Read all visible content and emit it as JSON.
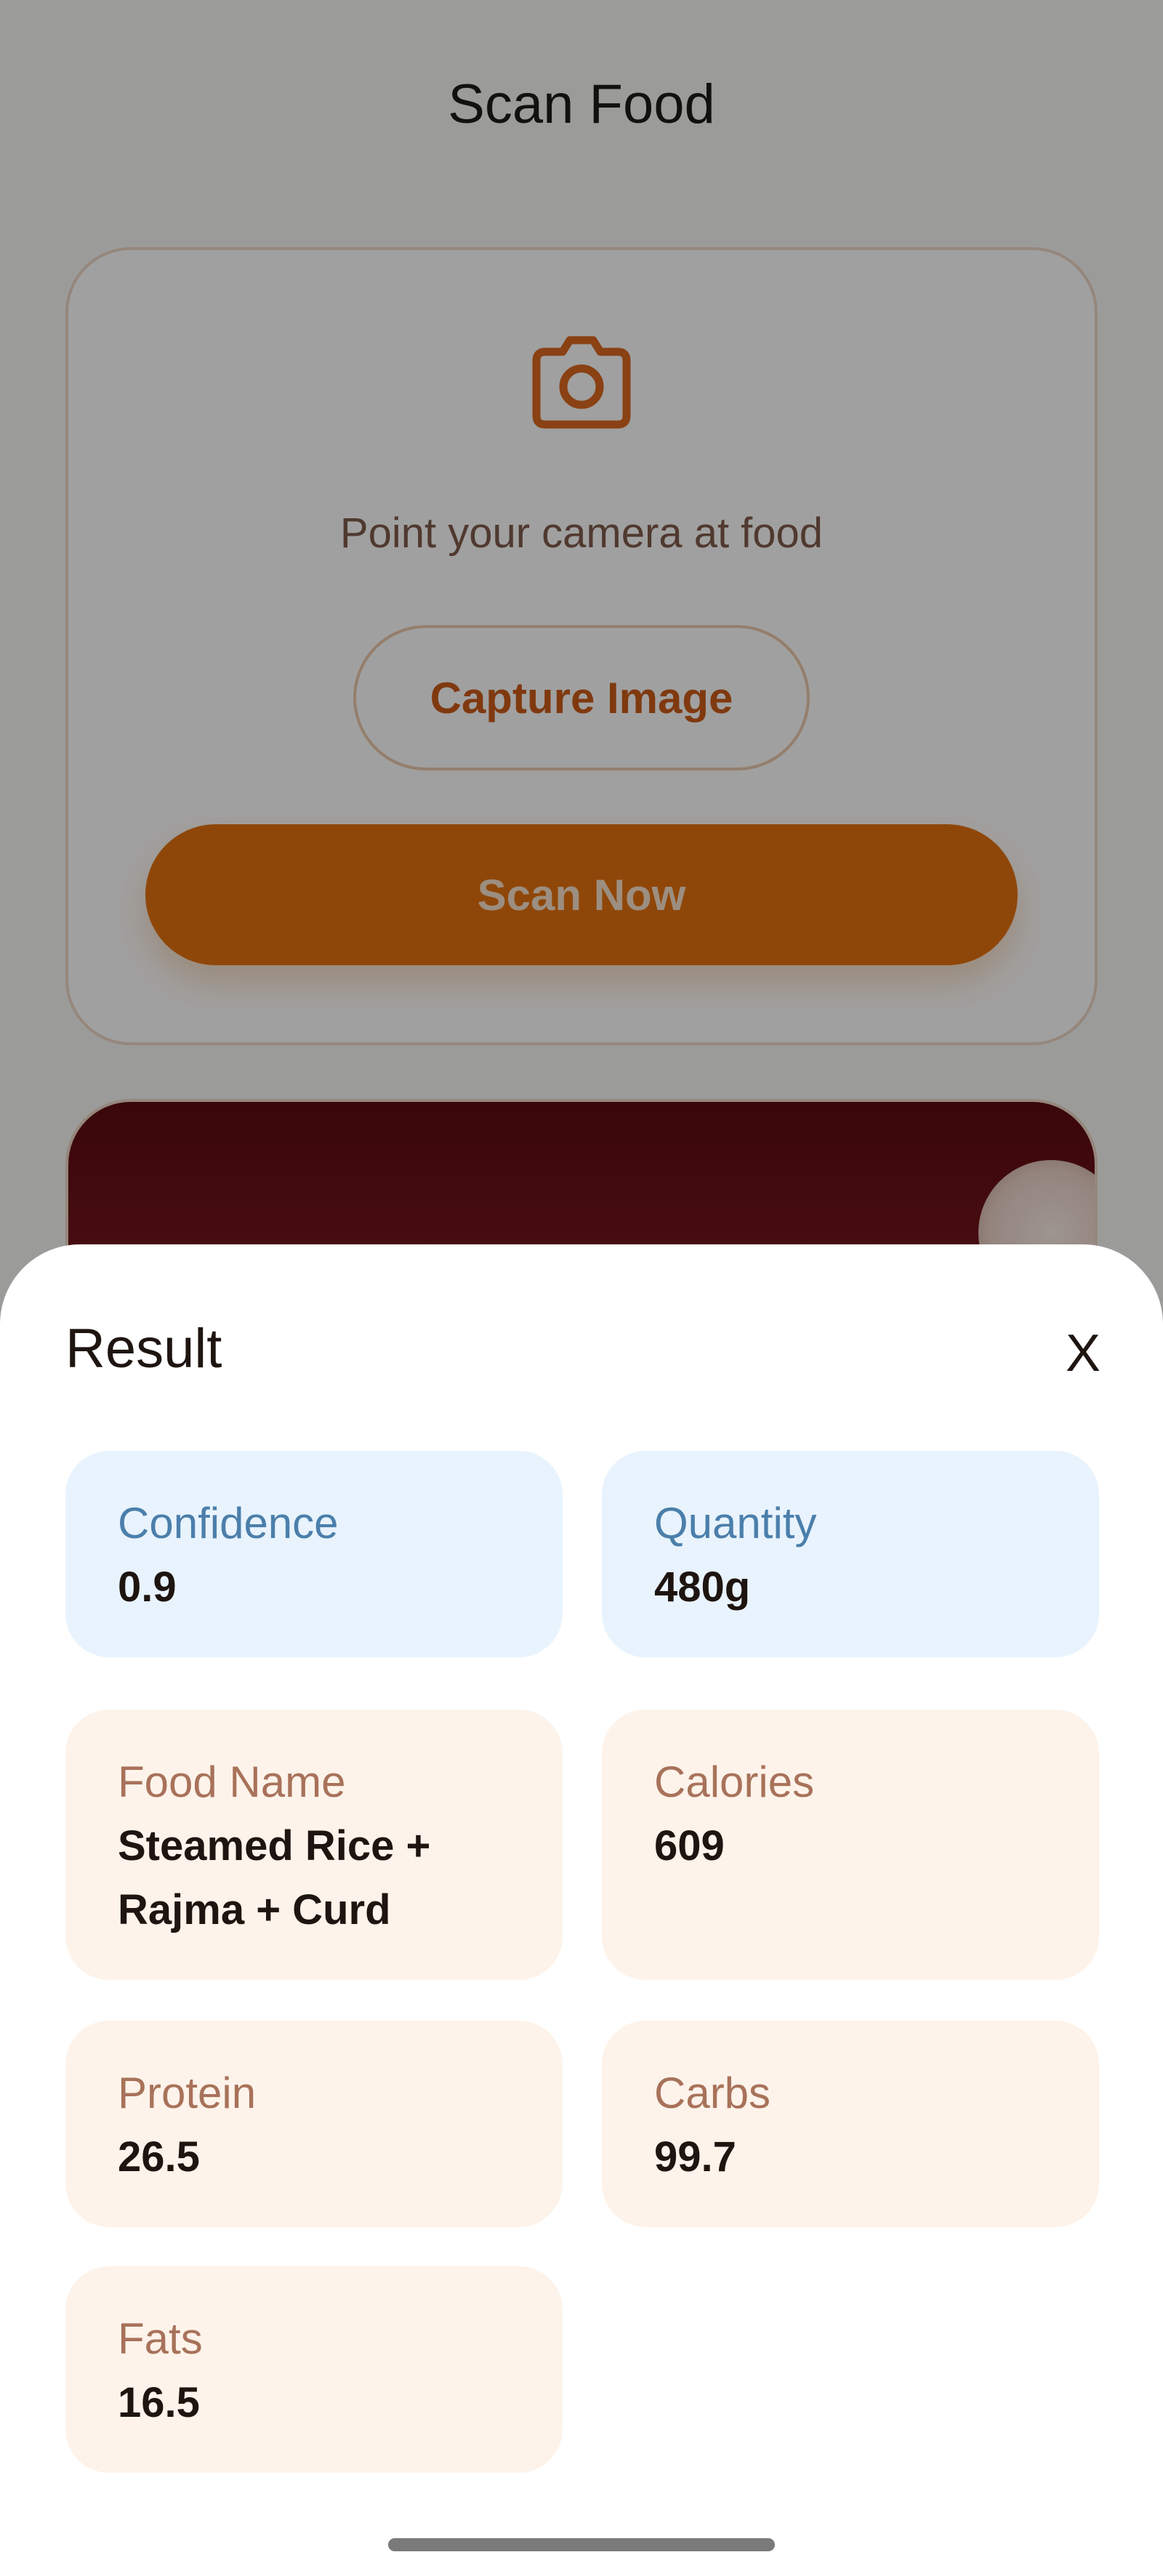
{
  "screen": {
    "title": "Scan Food",
    "hint": "Point your camera at food",
    "capture_label": "Capture Image",
    "scan_label": "Scan Now",
    "accent_color": "#e0700f",
    "icon": "camera-icon"
  },
  "result_sheet": {
    "title": "Result",
    "close_label": "X",
    "confidence": {
      "label": "Confidence",
      "value": "0.9"
    },
    "quantity": {
      "label": "Quantity",
      "value": "480g"
    },
    "food_name": {
      "label": "Food Name",
      "value": "Steamed Rice + Rajma + Curd"
    },
    "calories": {
      "label": "Calories",
      "value": "609"
    },
    "protein": {
      "label": "Protein",
      "value": "26.5"
    },
    "carbs": {
      "label": "Carbs",
      "value": "99.7"
    },
    "fats": {
      "label": "Fats",
      "value": "16.5"
    }
  }
}
